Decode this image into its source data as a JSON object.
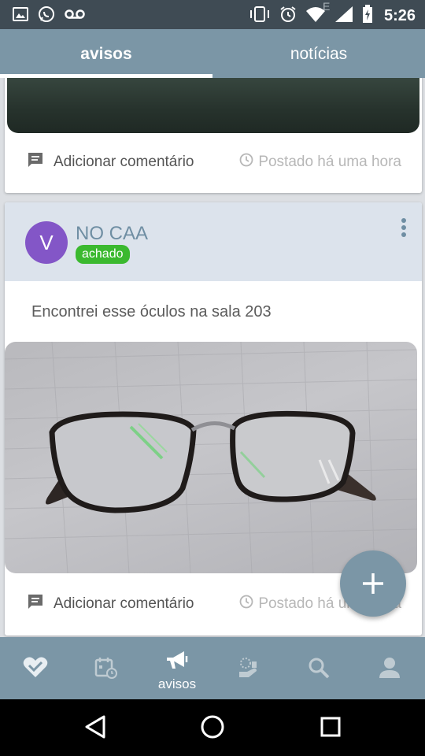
{
  "status_bar": {
    "time": "5:26",
    "network_label": "E",
    "icons": [
      "image-icon",
      "whatsapp-icon",
      "voicemail-icon",
      "vibrate-icon",
      "alarm-icon",
      "wifi-icon",
      "signal-icon",
      "battery-charging-icon"
    ]
  },
  "top_tabs": [
    {
      "label": "avisos",
      "active": true
    },
    {
      "label": "notícias",
      "active": false
    }
  ],
  "posts": [
    {
      "footer": {
        "comment_label": "Adicionar comentário",
        "posted_label": "Postado há uma hora"
      }
    },
    {
      "author": "NO CAA",
      "avatar_letter": "V",
      "tag": "achado",
      "text": "Encontrei esse óculos na sala 203",
      "footer": {
        "comment_label": "Adicionar comentário",
        "posted_label": "Postado há uma hora"
      }
    }
  ],
  "fab": {
    "icon": "plus-icon"
  },
  "bottom_nav": [
    {
      "icon": "heart-icon",
      "label": "",
      "active": false
    },
    {
      "icon": "calendar-clock-icon",
      "label": "",
      "active": false
    },
    {
      "icon": "megaphone-icon",
      "label": "avisos",
      "active": true
    },
    {
      "icon": "hand-coins-icon",
      "label": "",
      "active": false
    },
    {
      "icon": "search-icon",
      "label": "",
      "active": false
    },
    {
      "icon": "person-icon",
      "label": "",
      "active": false
    }
  ],
  "system_nav": [
    "back-icon",
    "home-icon",
    "recents-icon"
  ],
  "colors": {
    "primary": "#7b96a6",
    "status_bar": "#3f4b54",
    "avatar": "#8356c7",
    "tag": "#3bb92f",
    "card_header": "#dce3ec"
  }
}
